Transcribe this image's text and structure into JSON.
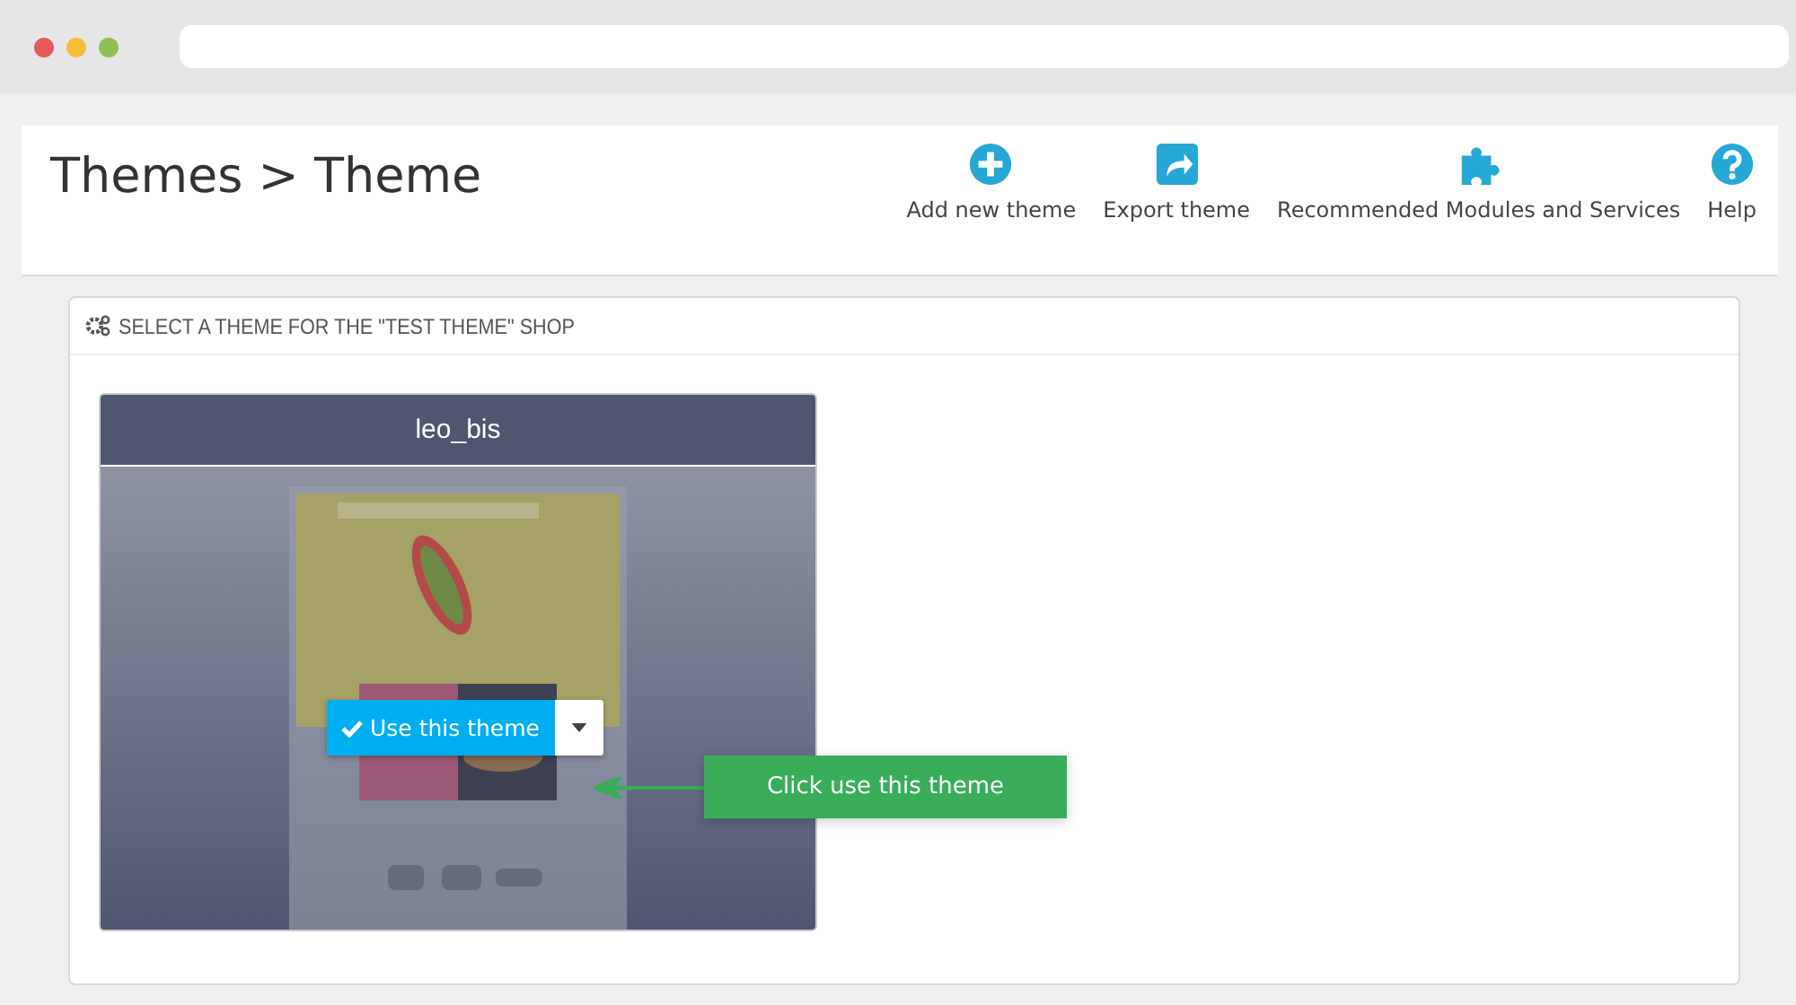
{
  "breadcrumb": "Themes > Theme",
  "toolbar": [
    {
      "kind": "add",
      "label": "Add new theme"
    },
    {
      "kind": "export",
      "label": "Export theme"
    },
    {
      "kind": "modules",
      "label": "Recommended Modules and Services"
    },
    {
      "kind": "help",
      "label": "Help"
    }
  ],
  "panel": {
    "title": "SELECT A THEME FOR THE \"TEST THEME\" SHOP"
  },
  "theme_card": {
    "name": "leo_bis",
    "use_button": "Use this theme"
  },
  "callout": "Click use this theme"
}
